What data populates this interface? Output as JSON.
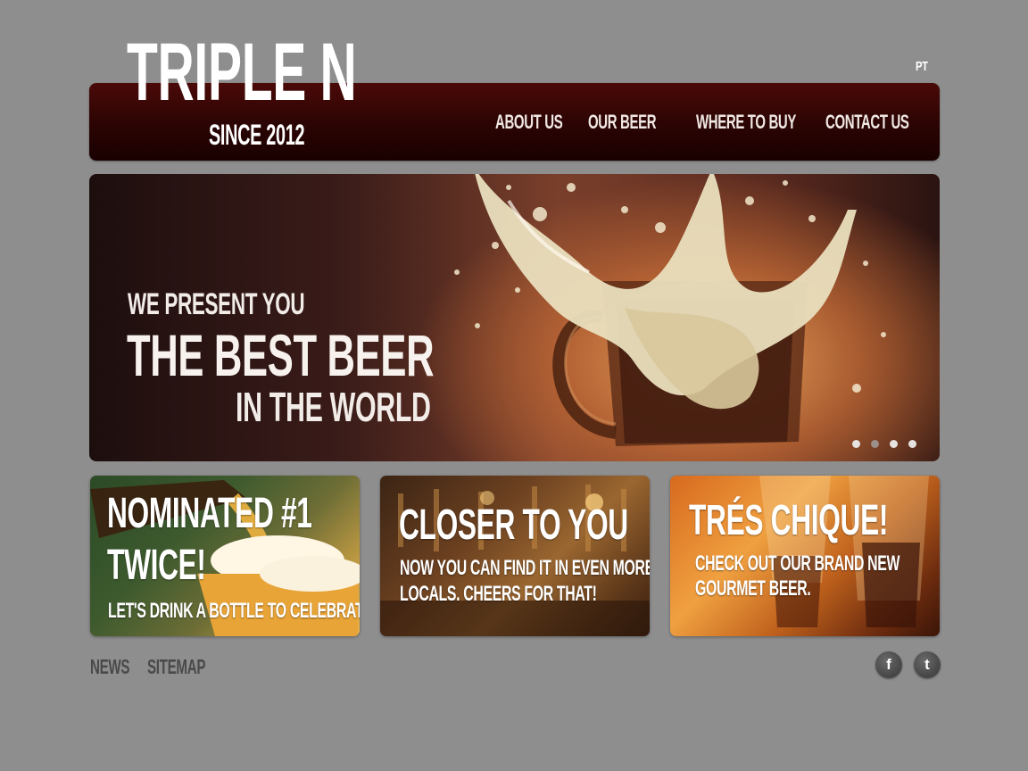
{
  "header": {
    "logo_title": "TRIPLE N",
    "logo_subtitle": "SINCE 2012",
    "language": "PT",
    "nav": [
      "ABOUT US",
      "OUR BEER",
      "WHERE TO BUY",
      "CONTACT US"
    ]
  },
  "hero": {
    "line1": "WE PRESENT YOU",
    "line2": "THE BEST BEER",
    "line3": "IN THE WORLD",
    "slides_total": 4,
    "active_slide": 2
  },
  "cards": [
    {
      "title_line1": "NOMINATED #1",
      "title_line2": "TWICE!",
      "text": "LET'S DRINK A BOTTLE TO CELEBRATE!"
    },
    {
      "title": "CLOSER TO YOU",
      "text_line1": "NOW YOU CAN FIND IT IN EVEN MORE",
      "text_line2": "LOCALS. CHEERS FOR THAT!"
    },
    {
      "title": "TRÉS CHIQUE!",
      "text_line1": "CHECK OUT OUR BRAND NEW",
      "text_line2": "GOURMET BEER."
    }
  ],
  "footer": {
    "links": [
      "NEWS",
      "SITEMAP"
    ],
    "social": [
      "facebook-icon",
      "twitter-icon"
    ]
  },
  "colors": {
    "background": "#8e8e8e",
    "navbar": "#2a0403",
    "footer_text": "#4a4a4a"
  }
}
